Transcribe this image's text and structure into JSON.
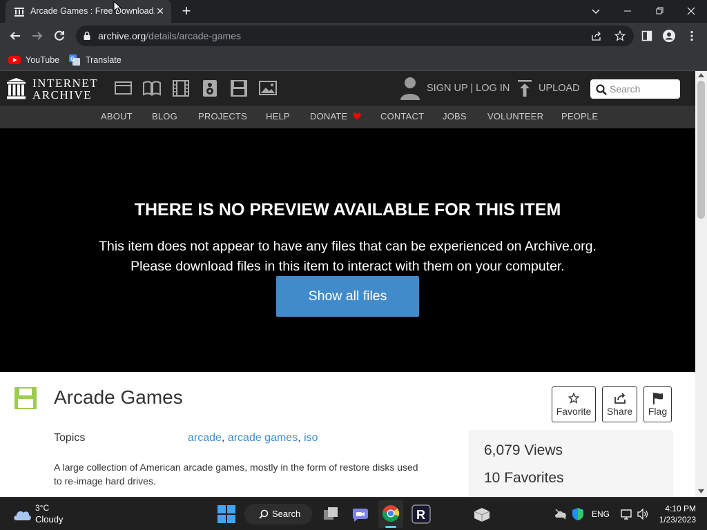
{
  "browser": {
    "tab_title": "Arcade Games : Free Download, B",
    "url_host": "archive.org",
    "url_path": "/details/arcade-games",
    "bookmarks": [
      {
        "label": "YouTube",
        "icon": "youtube-icon"
      },
      {
        "label": "Translate",
        "icon": "translate-icon"
      }
    ]
  },
  "archive_header": {
    "logo_line1": "INTERNET",
    "logo_line2": "ARCHIVE",
    "media_icons": [
      "web-icon",
      "texts-icon",
      "video-icon",
      "audio-icon",
      "software-icon",
      "images-icon"
    ],
    "signin": "SIGN UP | LOG IN",
    "upload": "UPLOAD",
    "search_placeholder": "Search",
    "nav": [
      "ABOUT",
      "BLOG",
      "PROJECTS",
      "HELP",
      "DONATE",
      "CONTACT",
      "JOBS",
      "VOLUNTEER",
      "PEOPLE"
    ]
  },
  "preview": {
    "title": "THERE IS NO PREVIEW AVAILABLE FOR THIS ITEM",
    "line1": "This item does not appear to have any files that can be experienced on Archive.org.",
    "line2": "Please download files in this item to interact with them on your computer.",
    "button": "Show all files"
  },
  "item": {
    "title": "Arcade Games",
    "actions": [
      "Favorite",
      "Share",
      "Flag"
    ],
    "topics_label": "Topics",
    "topics": [
      "arcade",
      "arcade games",
      "iso"
    ],
    "description": "A large collection of American arcade games, mostly in the form of restore disks used to re-image hard drives.",
    "views": "6,079 Views",
    "favorites": "10 Favorites"
  },
  "taskbar": {
    "weather_temp": "3°C",
    "weather_desc": "Cloudy",
    "search_label": "Search",
    "language": "ENG",
    "time": "4:10 PM",
    "date": "1/23/2023"
  },
  "colors": {
    "accent_blue": "#428bca",
    "software_green": "#9ecc4d",
    "donate_red": "#ff0000"
  }
}
